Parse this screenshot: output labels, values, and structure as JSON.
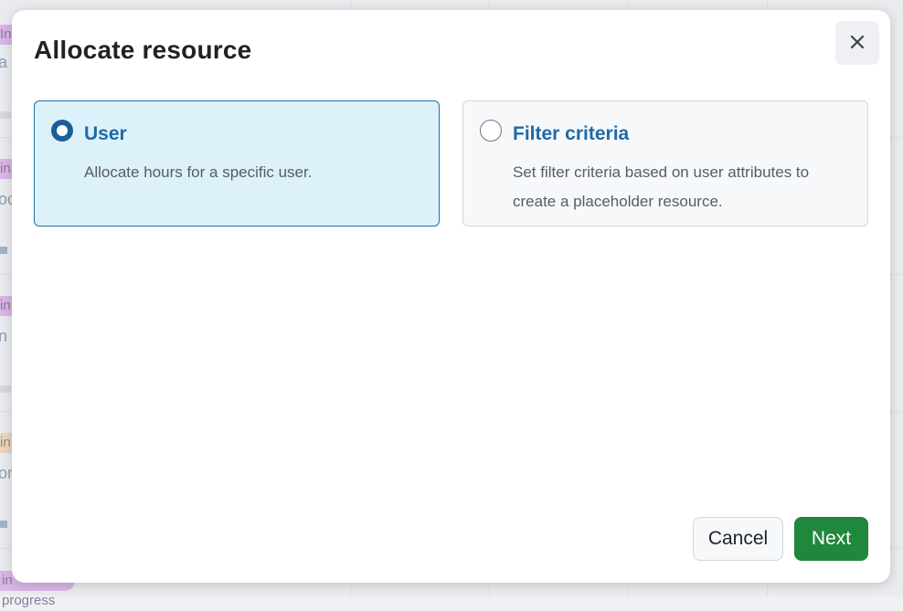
{
  "background": {
    "badges": [
      "In",
      "in",
      "in",
      "in",
      "in progress"
    ],
    "texts": [
      "a s",
      "oc",
      "n",
      "on"
    ]
  },
  "modal": {
    "title": "Allocate resource",
    "close_icon": "close-icon",
    "options": [
      {
        "label": "User",
        "description": "Allocate hours for a specific user.",
        "selected": true
      },
      {
        "label": "Filter criteria",
        "description": "Set filter criteria based on user attributes to create a placeholder resource.",
        "selected": false
      }
    ],
    "buttons": {
      "cancel": "Cancel",
      "next": "Next"
    }
  },
  "colors": {
    "selected_bg": "#ddf1fb",
    "selected_border": "#1f6fa8",
    "primary_button": "#1f883d",
    "link_title": "#1f69a6"
  }
}
